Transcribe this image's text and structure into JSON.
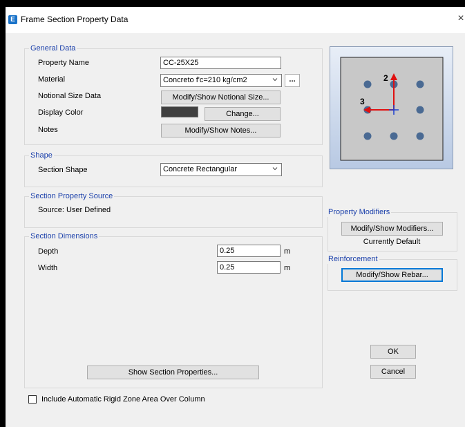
{
  "window": {
    "title": "Frame Section Property Data",
    "close_glyph": "×",
    "app_icon_letter": "E"
  },
  "general": {
    "heading": "General Data",
    "property_name_label": "Property Name",
    "property_name_value": "CC-25X25",
    "material_label": "Material",
    "material_value": "Concreto f'c=210 kg/cm2",
    "material_more_button": "...",
    "notional_label": "Notional Size Data",
    "notional_button": "Modify/Show Notional Size...",
    "display_color_label": "Display Color",
    "display_color_value": "#404040",
    "change_button": "Change...",
    "notes_label": "Notes",
    "notes_button": "Modify/Show Notes..."
  },
  "shape": {
    "heading": "Shape",
    "section_shape_label": "Section Shape",
    "section_shape_value": "Concrete Rectangular"
  },
  "source": {
    "heading": "Section Property Source",
    "source_text": "Source:  User Defined"
  },
  "dimensions": {
    "heading": "Section Dimensions",
    "depth_label": "Depth",
    "depth_value": "0.25",
    "depth_unit": "m",
    "width_label": "Width",
    "width_value": "0.25",
    "width_unit": "m",
    "show_props_button": "Show Section Properties..."
  },
  "preview": {
    "axis_2_label": "2",
    "axis_3_label": "3"
  },
  "modifiers": {
    "heading": "Property Modifiers",
    "button": "Modify/Show Modifiers...",
    "status": "Currently Default"
  },
  "reinforcement": {
    "heading": "Reinforcement",
    "button": "Modify/Show Rebar..."
  },
  "actions": {
    "ok": "OK",
    "cancel": "Cancel"
  },
  "rigid_zone": {
    "label": "Include Automatic Rigid Zone Area Over Column",
    "checked": false
  }
}
